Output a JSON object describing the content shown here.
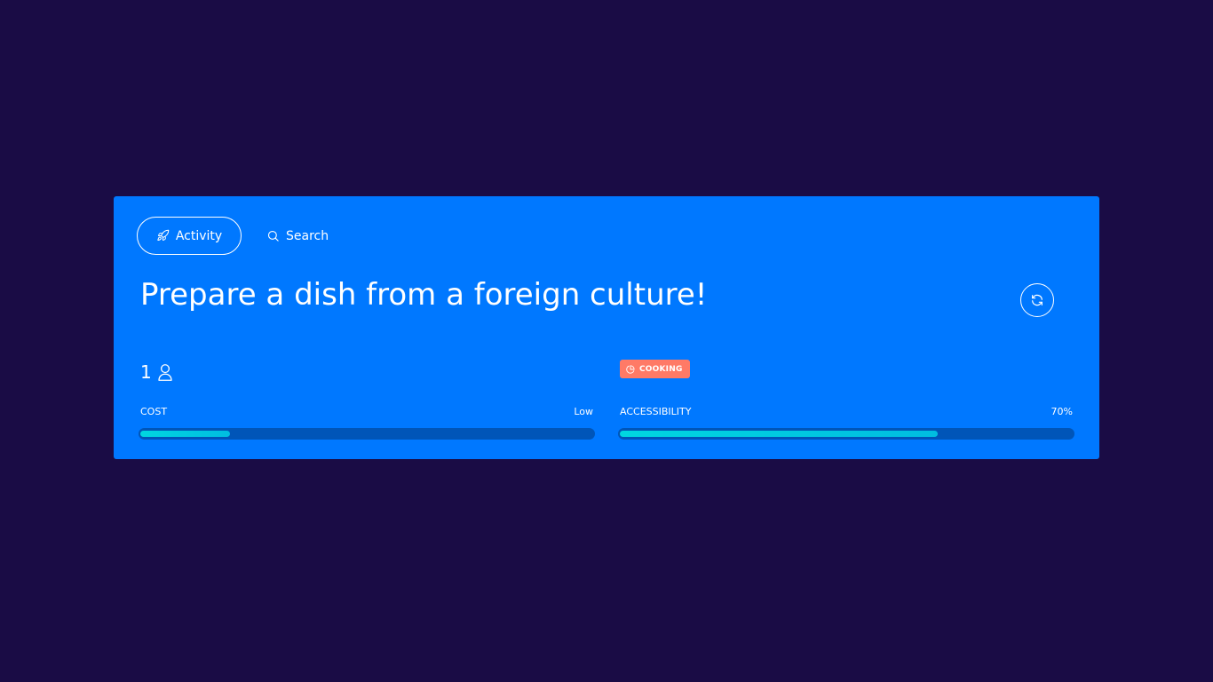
{
  "tabs": {
    "activity_label": "Activity",
    "search_label": "Search"
  },
  "activity": {
    "title": "Prepare a dish from a foreign culture!",
    "participants": "1",
    "type_badge": "COOKING"
  },
  "metrics": {
    "cost": {
      "label": "COST",
      "value_text": "Low",
      "fill_percent": 20
    },
    "accessibility": {
      "label": "ACCESSIBILITY",
      "value_text": "70%",
      "fill_percent": 70
    }
  },
  "colors": {
    "background": "#1a0c45",
    "card": "#0078ff",
    "badge": "#ff7a66",
    "bar_fill": "#00d6e0",
    "bar_track": "#0055b8"
  },
  "icons": {
    "activity_tab": "rocket-icon",
    "search_tab": "search-icon",
    "refresh": "refresh-icon",
    "participants": "person-icon",
    "badge": "pie-chart-icon"
  }
}
